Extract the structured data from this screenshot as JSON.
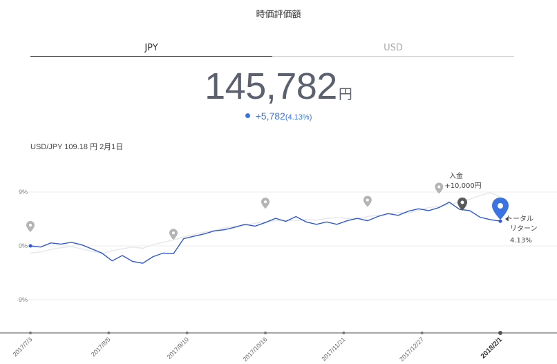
{
  "header": {
    "title": "時価評価額"
  },
  "tabs": [
    {
      "label": "JPY",
      "active": true
    },
    {
      "label": "USD",
      "active": false
    }
  ],
  "total": {
    "value": "145,782",
    "unit": "円"
  },
  "change": {
    "value": "+5,782",
    "percent": "(4.13%)",
    "color": "#3b74e0"
  },
  "fx_rate": "USD/JPY 109.18 円 2月1日",
  "deposit_marker": {
    "label": "入金",
    "amount": "+10,000円"
  },
  "total_return": {
    "line1": "トータル",
    "line2": "リターン",
    "value": "4.13%"
  },
  "colors": {
    "portfolio": "#2d57d6",
    "benchmark": "#e6e8ee",
    "marker": "#b5b5b5",
    "current": "#3b74e0"
  },
  "chart_data": {
    "type": "line",
    "y_ticks": [
      "9%",
      "0%",
      "-9%"
    ],
    "ylim": [
      -14,
      14
    ],
    "x_ticks": [
      "2017/7/3",
      "2017/8/5",
      "2017/9/10",
      "2017/10/16",
      "2017/11/21",
      "2017/12/27",
      "2018/2/1"
    ],
    "series": [
      {
        "role": "portfolio",
        "values": [
          0,
          -0.2,
          0.5,
          0.3,
          0.6,
          0.2,
          -0.5,
          -1.2,
          -2.5,
          -1.6,
          -2.6,
          -2.9,
          -1.8,
          -1.2,
          -1.3,
          1.2,
          1.6,
          2.0,
          2.5,
          2.7,
          3.1,
          3.6,
          3.3,
          3.9,
          4.6,
          4.1,
          4.9,
          4.0,
          3.6,
          4.0,
          3.6,
          4.2,
          4.6,
          4.2,
          4.9,
          5.4,
          5.1,
          5.8,
          6.2,
          5.9,
          6.4,
          7.3,
          6.1,
          5.9,
          4.8,
          4.4,
          4.13
        ]
      },
      {
        "role": "benchmark",
        "values": [
          -1.2,
          -1.0,
          -0.6,
          -0.3,
          -0.1,
          -0.5,
          -0.9,
          -1.3,
          -0.8,
          -0.5,
          -0.2,
          -0.4,
          0.2,
          0.6,
          1.0,
          1.5,
          1.9,
          2.3,
          2.6,
          3.0,
          3.3,
          3.4,
          3.8,
          4.0,
          4.2,
          4.3,
          4.2,
          4.4,
          4.3,
          4.6,
          4.7,
          4.6,
          4.5,
          4.9,
          5.1,
          5.3,
          5.6,
          5.5,
          5.9,
          6.4,
          6.6,
          6.9,
          7.3,
          7.8,
          8.4,
          8.9,
          8.2
        ]
      }
    ],
    "event_markers_at_index": [
      0,
      14,
      23,
      33,
      40,
      42
    ]
  }
}
